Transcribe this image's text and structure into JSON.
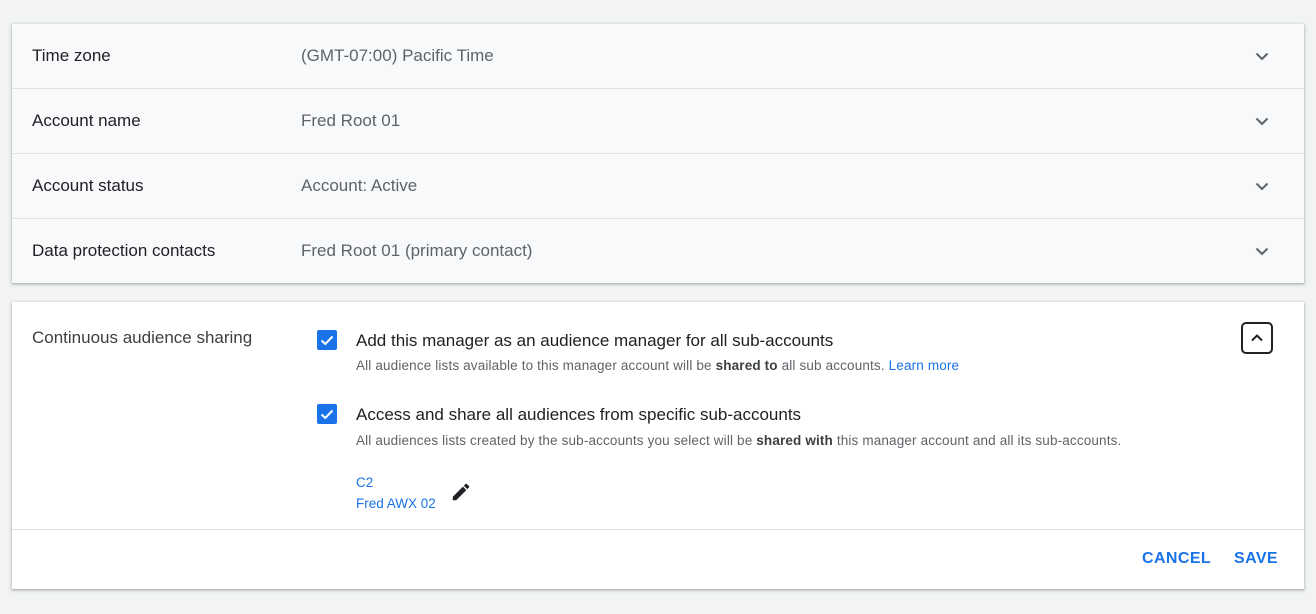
{
  "settings": [
    {
      "label": "Time zone",
      "value": "(GMT-07:00) Pacific Time"
    },
    {
      "label": "Account name",
      "value": "Fred Root 01"
    },
    {
      "label": "Account status",
      "value": "Account: Active"
    },
    {
      "label": "Data protection contacts",
      "value": "Fred Root 01 (primary contact)"
    }
  ],
  "audience": {
    "label": "Continuous audience sharing",
    "option1": {
      "checked": true,
      "title": "Add this manager as an audience manager for all sub-accounts",
      "desc_pre": "All audience lists available to this manager account will be ",
      "desc_bold": "shared to",
      "desc_post": " all sub accounts. ",
      "link": "Learn more"
    },
    "option2": {
      "checked": true,
      "title": "Access and share all audiences from specific sub-accounts",
      "desc_pre": "All audiences lists created by the sub-accounts you select will be ",
      "desc_bold": "shared with",
      "desc_post": " this manager account and all its sub-accounts.",
      "sub_accounts": [
        "C2",
        "Fred AWX 02"
      ]
    },
    "cancel_label": "CANCEL",
    "save_label": "SAVE"
  },
  "colors": {
    "accent": "#1a73e8",
    "text": "#202124",
    "secondary": "#5f6368"
  },
  "icons": {
    "row_toggle": "chevron-down-icon",
    "collapse": "chevron-up-icon",
    "edit": "pencil-icon",
    "check": "check-icon"
  }
}
